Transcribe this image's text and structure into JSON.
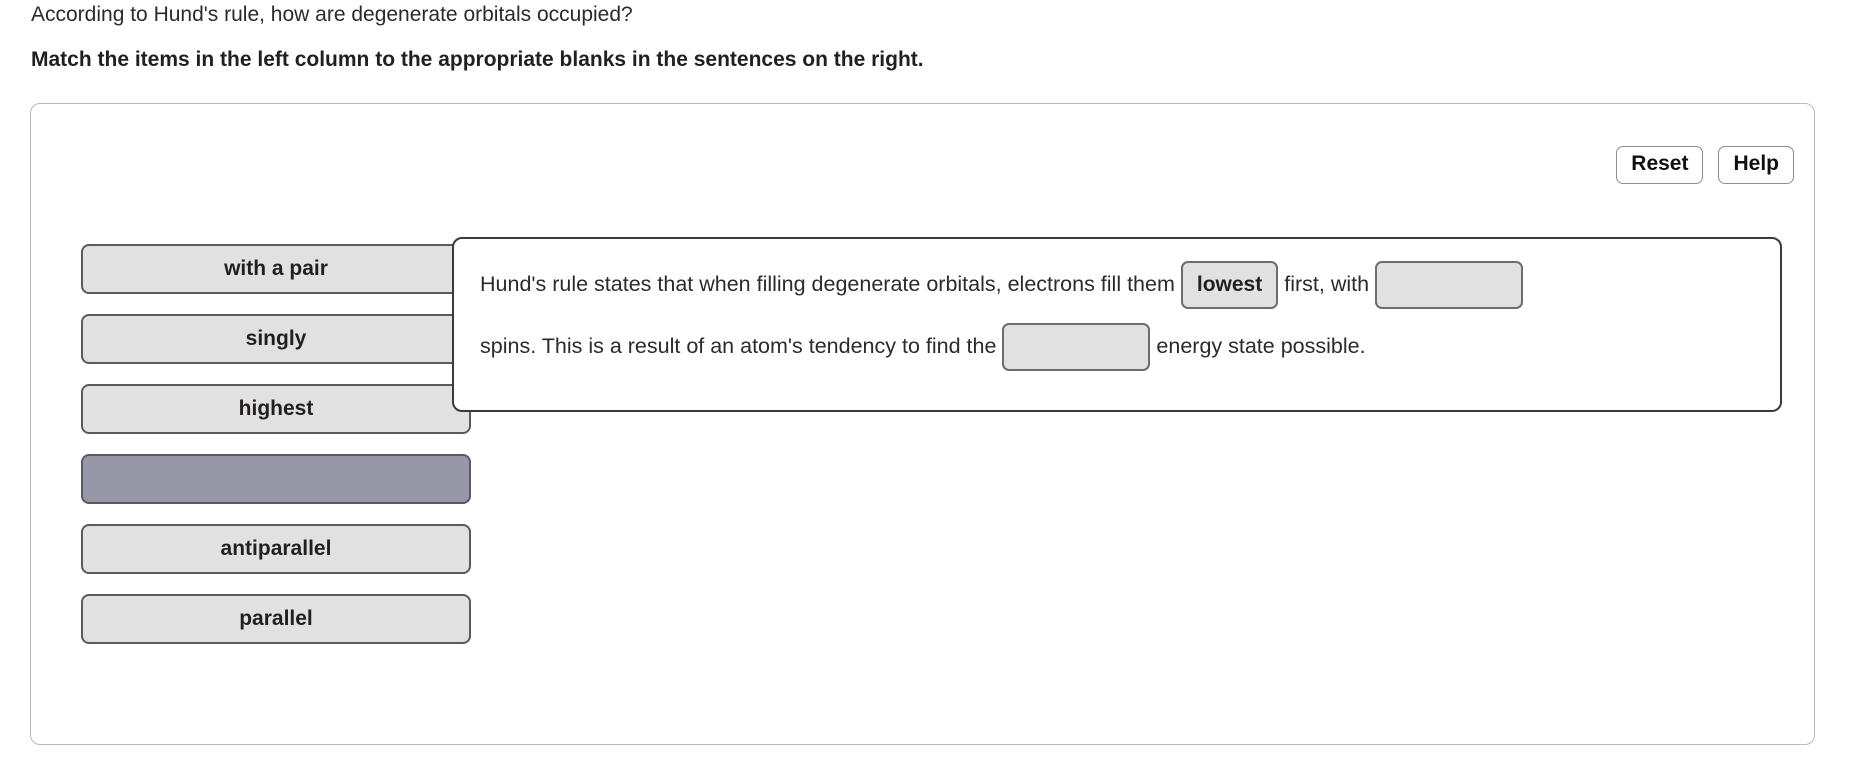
{
  "question": {
    "stem": "According to Hund's rule, how are degenerate orbitals occupied?",
    "instruction": "Match the items in the left column to the appropriate blanks in the sentences on the right."
  },
  "toolbar": {
    "reset_label": "Reset",
    "help_label": "Help"
  },
  "item_bank": {
    "items": [
      {
        "label": "with a pair",
        "state": "available"
      },
      {
        "label": "singly",
        "state": "available"
      },
      {
        "label": "highest",
        "state": "available"
      },
      {
        "label": "",
        "state": "placeholder"
      },
      {
        "label": "antiparallel",
        "state": "available"
      },
      {
        "label": "parallel",
        "state": "available"
      }
    ]
  },
  "sentence": {
    "segment_1": "Hund's rule states that when filling degenerate orbitals, electrons fill them",
    "blank_1_value": "lowest",
    "segment_2": "first, with",
    "blank_2_value": "",
    "segment_3": "spins. This is a result of an atom's tendency to find the",
    "blank_3_value": "",
    "segment_4": "energy state possible."
  },
  "colors": {
    "tile_fill": "#e1e1e1",
    "tile_border": "#5a5963",
    "placeholder_fill": "#9897a8",
    "panel_border": "#343b42",
    "outer_border": "#b9b9b9",
    "text": "#2b2b2b"
  }
}
